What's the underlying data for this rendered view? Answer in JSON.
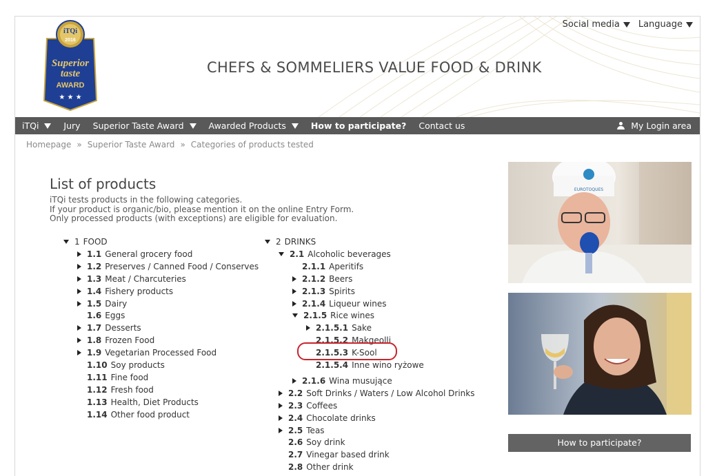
{
  "header": {
    "site_title": "CHEFS & SOMMELIERS VALUE FOOD & DRINK",
    "top_links": [
      "Social media",
      "Language"
    ],
    "award_logo": {
      "brand": "iTQi",
      "year": "2016",
      "line1": "Superior",
      "line2": "taste",
      "line3": "AWARD"
    }
  },
  "nav": {
    "items": [
      {
        "label": "iTQi",
        "dropdown": true
      },
      {
        "label": "Jury",
        "dropdown": false
      },
      {
        "label": "Superior Taste Award",
        "dropdown": true
      },
      {
        "label": "Awarded Products",
        "dropdown": true
      },
      {
        "label": "How to participate?",
        "dropdown": false
      },
      {
        "label": "Contact us",
        "dropdown": false
      }
    ],
    "login": "My Login area"
  },
  "breadcrumb": {
    "items": [
      "Homepage",
      "Superior Taste Award",
      "Categories of products tested"
    ],
    "separator": "»"
  },
  "content": {
    "title": "List of products",
    "intro": [
      "iTQi tests products in the following categories.",
      "If your product is organic/bio, please mention it on the online Entry Form.",
      "Only processed products (with exceptions) are eligible for evaluation."
    ]
  },
  "tree_food": [
    {
      "code": "1",
      "label": "FOOD",
      "state": "open",
      "bold": false
    },
    {
      "code": "1.1",
      "label": "General grocery food",
      "state": "closed"
    },
    {
      "code": "1.2",
      "label": "Preserves / Canned Food / Conserves",
      "state": "closed"
    },
    {
      "code": "1.3",
      "label": "Meat / Charcuteries",
      "state": "closed"
    },
    {
      "code": "1.4",
      "label": "Fishery products",
      "state": "closed"
    },
    {
      "code": "1.5",
      "label": "Dairy",
      "state": "closed"
    },
    {
      "code": "1.6",
      "label": "Eggs",
      "state": "leaf"
    },
    {
      "code": "1.7",
      "label": "Desserts",
      "state": "closed"
    },
    {
      "code": "1.8",
      "label": "Frozen Food",
      "state": "closed"
    },
    {
      "code": "1.9",
      "label": "Vegetarian Processed Food",
      "state": "closed"
    },
    {
      "code": "1.10",
      "label": "Soy products",
      "state": "leaf"
    },
    {
      "code": "1.11",
      "label": "Fine food",
      "state": "leaf"
    },
    {
      "code": "1.12",
      "label": "Fresh food",
      "state": "leaf"
    },
    {
      "code": "1.13",
      "label": "Health, Diet Products",
      "state": "leaf"
    },
    {
      "code": "1.14",
      "label": "Other food product",
      "state": "leaf"
    }
  ],
  "tree_drinks": [
    {
      "code": "2",
      "label": "DRINKS",
      "state": "open",
      "bold": false
    },
    {
      "code": "2.1",
      "label": "Alcoholic beverages",
      "state": "open"
    },
    {
      "code": "2.1.1",
      "label": "Aperitifs",
      "state": "leaf"
    },
    {
      "code": "2.1.2",
      "label": "Beers",
      "state": "closed"
    },
    {
      "code": "2.1.3",
      "label": "Spirits",
      "state": "closed"
    },
    {
      "code": "2.1.4",
      "label": "Liqueur wines",
      "state": "closed"
    },
    {
      "code": "2.1.5",
      "label": "Rice wines",
      "state": "open"
    },
    {
      "code": "2.1.5.1",
      "label": "Sake",
      "state": "closed"
    },
    {
      "code": "2.1.5.2",
      "label": "Makgeolli",
      "state": "leaf"
    },
    {
      "code": "2.1.5.3",
      "label": "K-Sool",
      "state": "leaf",
      "highlighted": true
    },
    {
      "code": "2.1.5.4",
      "label": "Inne wino ryżowe",
      "state": "leaf"
    },
    {
      "code": "2.1.6",
      "label": "Wina musujące",
      "state": "closed"
    },
    {
      "code": "2.2",
      "label": "Soft Drinks / Waters / Low Alcohol Drinks",
      "state": "closed"
    },
    {
      "code": "2.3",
      "label": "Coffees",
      "state": "closed"
    },
    {
      "code": "2.4",
      "label": "Chocolate drinks",
      "state": "closed"
    },
    {
      "code": "2.5",
      "label": "Teas",
      "state": "closed"
    },
    {
      "code": "2.6",
      "label": "Soy drink",
      "state": "leaf"
    },
    {
      "code": "2.7",
      "label": "Vinegar based drink",
      "state": "leaf"
    },
    {
      "code": "2.8",
      "label": "Other drink",
      "state": "leaf"
    }
  ],
  "sidebar": {
    "photo1_badge": "EUROTOQUES",
    "cta": "How to participate?"
  },
  "colors": {
    "nav_bg": "#595959",
    "cta_bg": "#636363",
    "highlight": "#c8232b",
    "award_blue": "#1f3f95",
    "award_gold": "#c9a43a"
  }
}
